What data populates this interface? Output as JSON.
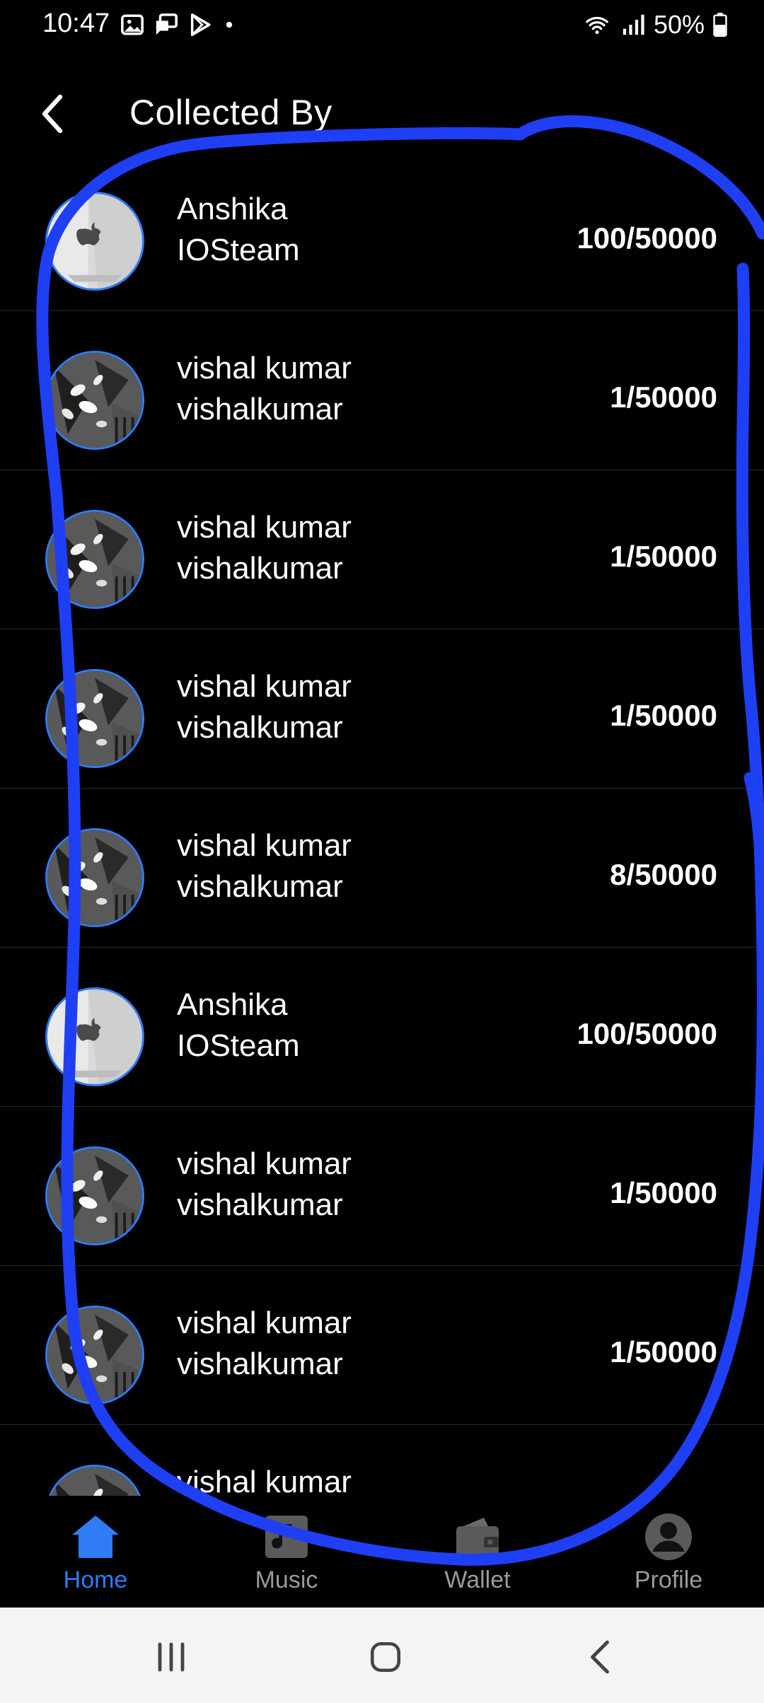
{
  "status_bar": {
    "time": "10:47",
    "battery": "50%"
  },
  "header": {
    "title": "Collected By"
  },
  "items": [
    {
      "name": "Anshika",
      "username": "IOSteam",
      "count": "100/50000",
      "avatar": "apple-laptop"
    },
    {
      "name": "vishal kumar",
      "username": "vishalkumar",
      "count": "1/50000",
      "avatar": "plant"
    },
    {
      "name": "vishal kumar",
      "username": "vishalkumar",
      "count": "1/50000",
      "avatar": "plant"
    },
    {
      "name": "vishal kumar",
      "username": "vishalkumar",
      "count": "1/50000",
      "avatar": "plant"
    },
    {
      "name": "vishal kumar",
      "username": "vishalkumar",
      "count": "8/50000",
      "avatar": "plant"
    },
    {
      "name": "Anshika",
      "username": "IOSteam",
      "count": "100/50000",
      "avatar": "apple-laptop"
    },
    {
      "name": "vishal kumar",
      "username": "vishalkumar",
      "count": "1/50000",
      "avatar": "plant"
    },
    {
      "name": "vishal kumar",
      "username": "vishalkumar",
      "count": "1/50000",
      "avatar": "plant"
    },
    {
      "name": "vishal kumar",
      "username": "",
      "count": "",
      "avatar": "plant"
    }
  ],
  "nav": [
    {
      "label": "Home",
      "icon": "home-icon",
      "active": true
    },
    {
      "label": "Music",
      "icon": "music-icon",
      "active": false
    },
    {
      "label": "Wallet",
      "icon": "wallet-icon",
      "active": false
    },
    {
      "label": "Profile",
      "icon": "profile-icon",
      "active": false
    }
  ],
  "colors": {
    "accent": "#2f7cf6",
    "background": "#000000",
    "annotation": "#1f3ff5"
  }
}
